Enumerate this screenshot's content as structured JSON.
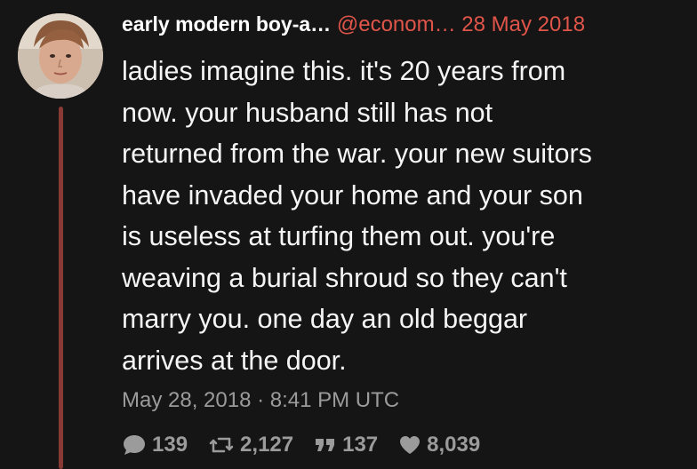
{
  "author": {
    "display_name": "early modern boy-a…",
    "handle": "@econom…",
    "date": "28 May 2018"
  },
  "tweet": {
    "text": "ladies imagine this. it's 20 years from\nnow. your husband still has not\nreturned from the war. your new suitors\nhave invaded your home and your son\nis useless at turfing them out. you're\nweaving a burial shroud so they can't\nmarry you. one day an old beggar\narrives at the door.",
    "timestamp": "May 28, 2018 · 8:41 PM UTC"
  },
  "actions": {
    "replies": "139",
    "retweets": "2,127",
    "quotes": "137",
    "likes": "8,039"
  },
  "colors": {
    "background": "#151515",
    "accent": "#e0554a",
    "thread_line": "#8a3a35",
    "muted": "#9b9b9b"
  },
  "icons": {
    "reply": "speech-bubble-icon",
    "retweet": "retweet-icon",
    "quote": "quote-icon",
    "like": "heart-icon"
  }
}
